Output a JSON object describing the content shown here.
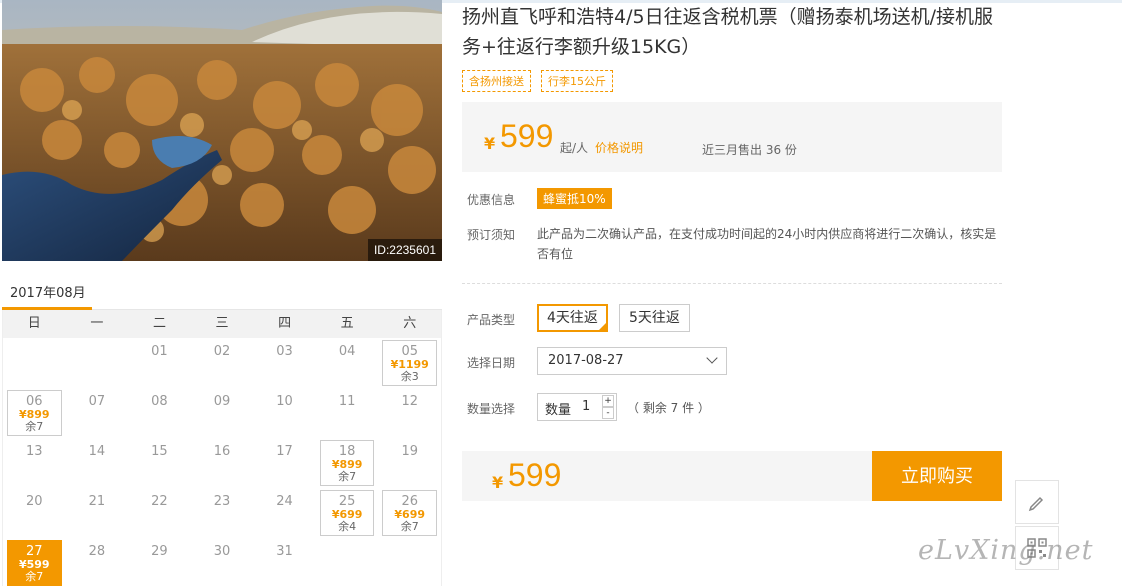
{
  "product": {
    "title": "扬州直飞呼和浩特4/5日往返含税机票（赠扬泰机场送机/接机服务+往返行李额升级15KG）",
    "tags": [
      "含扬州接送",
      "行李15公斤"
    ],
    "photo_id": "ID:2235601"
  },
  "price_box": {
    "currency": "¥",
    "price": "599",
    "unit": "起/人",
    "price_note_link": "价格说明",
    "sold": "近三月售出 36 份"
  },
  "discount": {
    "label": "优惠信息",
    "badge": "蜂蜜抵10%"
  },
  "booking_notice": {
    "label": "预订须知",
    "text": "此产品为二次确认产品，在支付成功时间起的24小时内供应商将进行二次确认，核实是否有位"
  },
  "product_type": {
    "label": "产品类型",
    "options": [
      "4天往返",
      "5天往返"
    ],
    "selected": "4天往返"
  },
  "date_select": {
    "label": "选择日期",
    "value": "2017-08-27"
  },
  "quantity": {
    "label": "数量选择",
    "field_label": "数量",
    "value": "1",
    "plus": "+",
    "minus": "-",
    "stock": "（ 剩余 7 件 ）"
  },
  "buy_bar": {
    "currency": "¥",
    "price": "599",
    "button": "立即购买"
  },
  "calendar": {
    "month_label": "2017年08月",
    "weekdays": [
      "日",
      "一",
      "二",
      "三",
      "四",
      "五",
      "六"
    ],
    "leading_blanks": 2,
    "days": [
      {
        "d": "01"
      },
      {
        "d": "02"
      },
      {
        "d": "03"
      },
      {
        "d": "04"
      },
      {
        "d": "05",
        "price": "¥1199",
        "remain": "余3"
      },
      {
        "d": "06",
        "price": "¥899",
        "remain": "余7"
      },
      {
        "d": "07"
      },
      {
        "d": "08"
      },
      {
        "d": "09"
      },
      {
        "d": "10"
      },
      {
        "d": "11"
      },
      {
        "d": "12"
      },
      {
        "d": "13"
      },
      {
        "d": "14"
      },
      {
        "d": "15"
      },
      {
        "d": "16"
      },
      {
        "d": "17"
      },
      {
        "d": "18",
        "price": "¥899",
        "remain": "余7"
      },
      {
        "d": "19"
      },
      {
        "d": "20"
      },
      {
        "d": "21"
      },
      {
        "d": "22"
      },
      {
        "d": "23"
      },
      {
        "d": "24"
      },
      {
        "d": "25",
        "price": "¥699",
        "remain": "余4"
      },
      {
        "d": "26",
        "price": "¥699",
        "remain": "余7"
      },
      {
        "d": "27",
        "price": "¥599",
        "remain": "余7",
        "selected": true
      },
      {
        "d": "28"
      },
      {
        "d": "29"
      },
      {
        "d": "30"
      },
      {
        "d": "31"
      }
    ]
  },
  "side_tools": [
    "pencil-icon",
    "qrcode-icon"
  ],
  "watermark": "eLvXing.net",
  "colors": {
    "accent": "#f39800",
    "panel": "#f5f5f5"
  }
}
